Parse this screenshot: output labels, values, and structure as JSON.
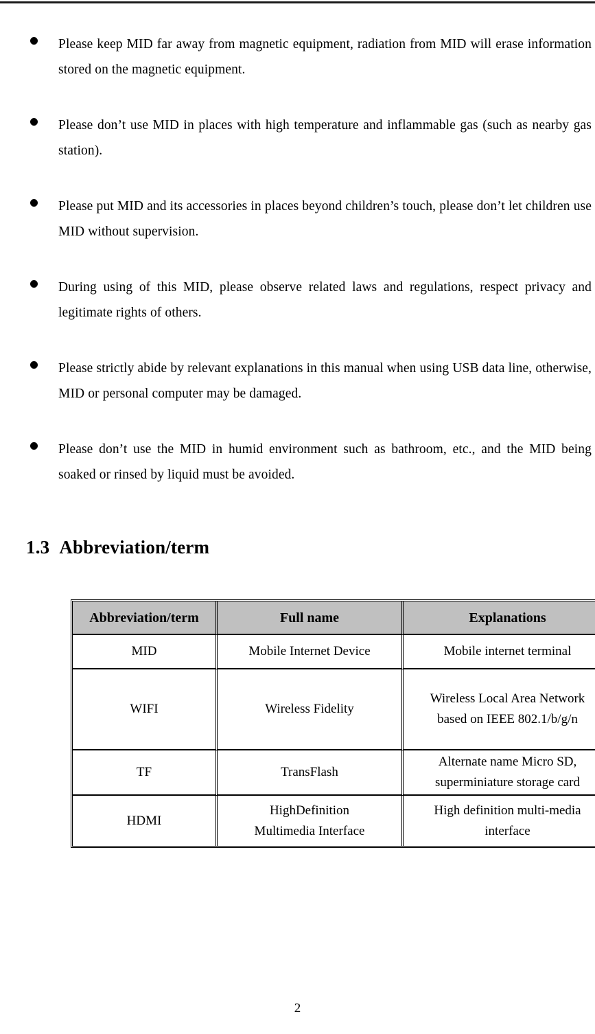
{
  "page": {
    "number": "2",
    "header_rule": true
  },
  "safety_notes": {
    "bullets": [
      {
        "marker": "filled-round-bullet",
        "text": "Please keep MID far away from magnetic equipment, radiation from MID will erase information stored on the magnetic equipment."
      },
      {
        "marker": "filled-round-bullet",
        "text": "Please don’t use MID in places with high temperature and inflammable gas (such as nearby gas station)."
      },
      {
        "marker": "filled-round-bullet",
        "text": "Please put MID and its accessories in places beyond children’s touch, please don’t let children use MID without supervision."
      },
      {
        "marker": "filled-round-bullet",
        "text": "During using of this MID, please observe related laws and regulations, respect privacy and legitimate rights of others."
      },
      {
        "marker": "filled-round-bullet",
        "text": "Please strictly abide by relevant explanations in this manual when using USB data line, otherwise, MID or personal computer may be damaged."
      },
      {
        "marker": "filled-round-bullet",
        "text": "Please don’t use the MID in humid environment such as bathroom, etc., and the MID being soaked or rinsed by liquid must be avoided."
      }
    ]
  },
  "section": {
    "number": "1.3",
    "title": "Abbreviation/term"
  },
  "abbrev_table": {
    "header_background": "#c0c0c0",
    "columns": [
      "Abbreviation/term",
      "Full name",
      "Explanations"
    ],
    "rows": [
      {
        "abbrev": "MID",
        "full_name": "Mobile Internet Device",
        "explanation_line1": "Mobile internet terminal",
        "explanation_line2": ""
      },
      {
        "abbrev": "WIFI",
        "full_name": "Wireless Fidelity",
        "explanation_line1": "Wireless Local Area Network",
        "explanation_line2": "based on IEEE 802.1/b/g/n"
      },
      {
        "abbrev": "TF",
        "full_name": "TransFlash",
        "explanation_line1": "Alternate name Micro SD,",
        "explanation_line2": "superminiature storage card"
      },
      {
        "abbrev": "HDMI",
        "full_name_line1": "HighDefinition",
        "full_name_line2": "Multimedia Interface",
        "explanation_line1": "High definition multi-media",
        "explanation_line2": "interface"
      }
    ]
  }
}
